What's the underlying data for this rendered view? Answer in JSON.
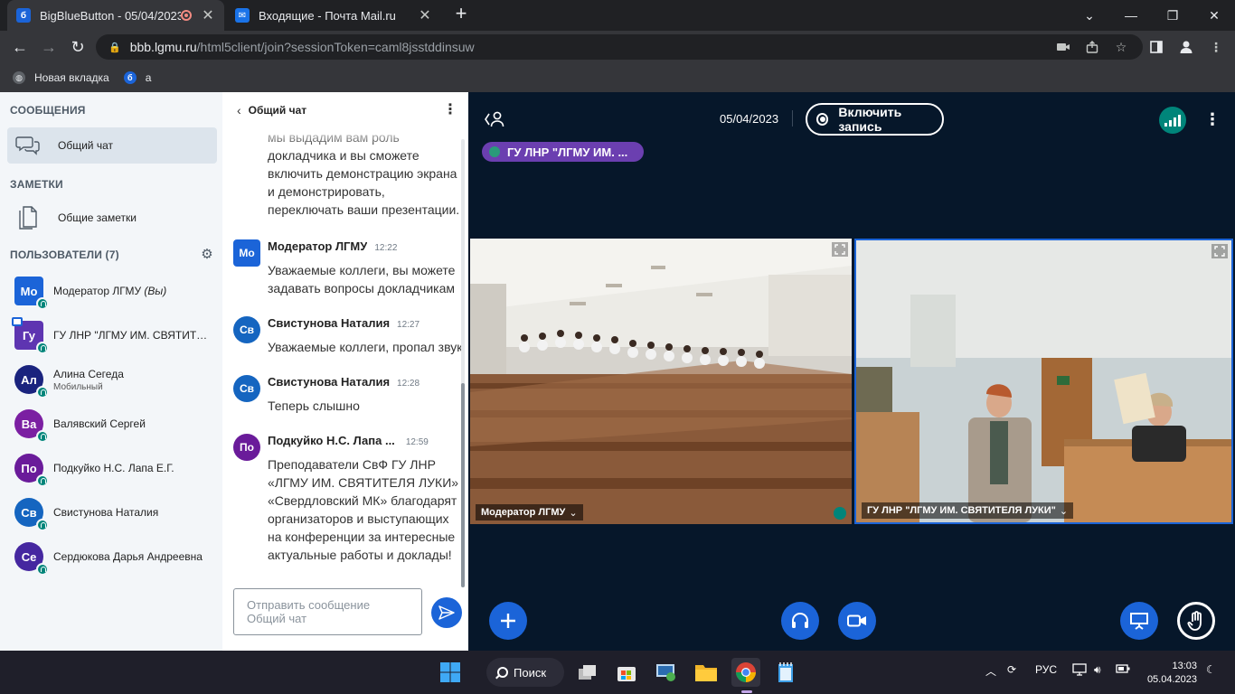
{
  "browser": {
    "tabs": [
      {
        "title": "BigBlueButton - 05/04/2023",
        "favicon": "б",
        "active": true
      },
      {
        "title": "Входящие - Почта Mail.ru",
        "favicon": "✉",
        "active": false
      }
    ],
    "url_host": "bbb.lgmu.ru",
    "url_path": "/html5client/join?sessionToken=caml8jsstddinsuw",
    "bookmarks": [
      {
        "label": "Новая вкладка",
        "icon": "globe-icon"
      },
      {
        "label": "a",
        "icon": "bbb-icon"
      }
    ]
  },
  "sidebar": {
    "messages_title": "СООБЩЕНИЯ",
    "public_chat_label": "Общий чат",
    "notes_title": "ЗАМЕТКИ",
    "shared_notes_label": "Общие заметки",
    "users_title": "ПОЛЬЗОВАТЕЛИ (7)",
    "users": [
      {
        "initials": "Мо",
        "name": "Модератор ЛГМУ",
        "suffix": "(Вы)",
        "sub": "",
        "color": "#1b64d8",
        "moderator": true,
        "presenter": false
      },
      {
        "initials": "Гу",
        "name": "ГУ ЛНР \"ЛГМУ ИМ. СВЯТИТЕЛЯ ЛУКИ\"",
        "suffix": "",
        "sub": "",
        "color": "#5e35b1",
        "moderator": true,
        "presenter": true
      },
      {
        "initials": "Ал",
        "name": "Алина Сегеда",
        "suffix": "",
        "sub": "Мобильный",
        "color": "#1a237e",
        "moderator": false,
        "presenter": false
      },
      {
        "initials": "Ва",
        "name": "Валявский Сергей",
        "suffix": "",
        "sub": "",
        "color": "#7b1fa2",
        "moderator": false,
        "presenter": false
      },
      {
        "initials": "По",
        "name": "Подкуйко Н.С. Лапа Е.Г.",
        "suffix": "",
        "sub": "",
        "color": "#6a1b9a",
        "moderator": false,
        "presenter": false
      },
      {
        "initials": "Св",
        "name": "Свистунова Наталия",
        "suffix": "",
        "sub": "",
        "color": "#1565c0",
        "moderator": false,
        "presenter": false
      },
      {
        "initials": "Се",
        "name": "Сердюкова Дарья Андреевна",
        "suffix": "",
        "sub": "",
        "color": "#4527a0",
        "moderator": false,
        "presenter": false
      }
    ]
  },
  "chat": {
    "title": "Общий чат",
    "continued_text": "мы выдадим вам роль докладчика и вы сможете включить демонстрацию экрана и демонстрировать, переключать ваши презентации.",
    "messages": [
      {
        "initials": "Мо",
        "name": "Модератор ЛГМУ",
        "time": "12:22",
        "text": "Уважаемые коллеги, вы можете задавать вопросы докладчикам",
        "color": "#1b64d8"
      },
      {
        "initials": "Св",
        "name": "Свистунова Наталия",
        "time": "12:27",
        "text": "Уважаемые коллеги, пропал звук",
        "color": "#1565c0"
      },
      {
        "initials": "Св",
        "name": "Свистунова Наталия",
        "time": "12:28",
        "text": "Теперь слышно",
        "color": "#1565c0"
      },
      {
        "initials": "По",
        "name": "Подкуйко Н.С. Лапа ...",
        "time": "12:59",
        "text": "Преподаватели СвФ ГУ ЛНР «ЛГМУ ИМ. СВЯТИТЕЛЯ ЛУКИ» «Свердловский МК» благодарят организаторов и выступающих на конференции за интересные актуальные работы и доклады!",
        "color": "#6a1b9a"
      }
    ],
    "input_placeholder": "Отправить сообщение Общий чат"
  },
  "main": {
    "date": "05/04/2023",
    "record_label": "Включить запись",
    "talking_indicator": "ГУ ЛНР \"ЛГМУ ИМ. ...",
    "videos": [
      {
        "label": "Модератор ЛГМУ"
      },
      {
        "label": "ГУ ЛНР \"ЛГМУ ИМ. СВЯТИТЕЛЯ ЛУКИ\""
      }
    ]
  },
  "taskbar": {
    "search_label": "Поиск",
    "language": "РУС",
    "time": "13:03",
    "date": "05.04.2023"
  },
  "colors": {
    "bbb_blue": "#1b64d8",
    "main_bg": "#06172a",
    "sidebar_bg": "#f3f6f9",
    "talking_purple": "#6b3fb0",
    "connection_teal": "#00857a"
  }
}
